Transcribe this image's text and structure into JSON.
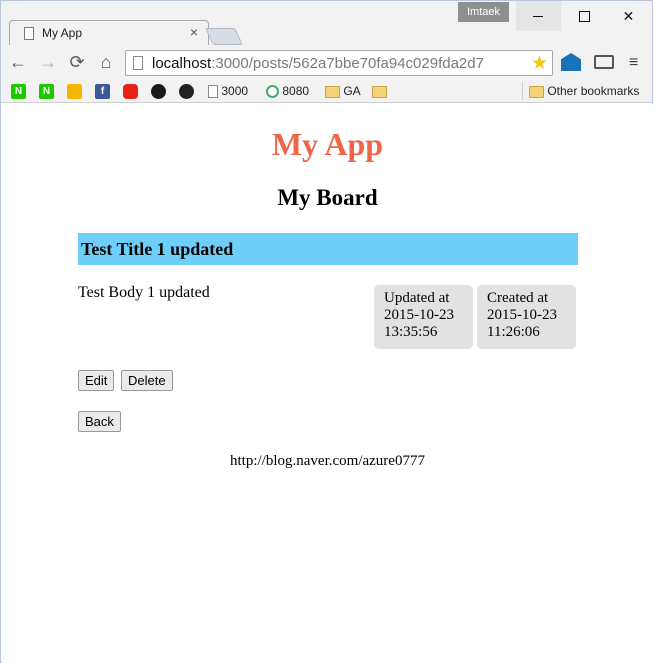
{
  "browser": {
    "tab_title": "My App",
    "tab_close": "×",
    "user_badge": "Imtaek",
    "url_host": "localhost",
    "url_path": ":3000/posts/562a7bbe70fa94c029fda2d7",
    "bookmarks": {
      "n1": "N",
      "n2": "N",
      "fb": "f",
      "item_3000": "3000",
      "item_8080": "8080",
      "item_ga": "GA",
      "other": "Other bookmarks"
    },
    "nav": {
      "back": "←",
      "forward": "→",
      "reload": "⟳",
      "home": "⌂",
      "menu": "≡",
      "star": "★"
    }
  },
  "page": {
    "app_title": "My App",
    "board_title": "My Board",
    "post": {
      "title": "Test Title 1 updated",
      "body": "Test Body 1 updated",
      "updated_label": "Updated at",
      "updated_date": "2015-10-23",
      "updated_time": "13:35:56",
      "created_label": "Created at",
      "created_date": "2015-10-23",
      "created_time": "11:26:06"
    },
    "buttons": {
      "edit": "Edit",
      "delete": "Delete",
      "back": "Back"
    },
    "footer_link": "http://blog.naver.com/azure0777"
  },
  "colors": {
    "app_title": "#f26448",
    "title_bar": "#6dcff9",
    "meta_box": "#e2e2e2"
  }
}
